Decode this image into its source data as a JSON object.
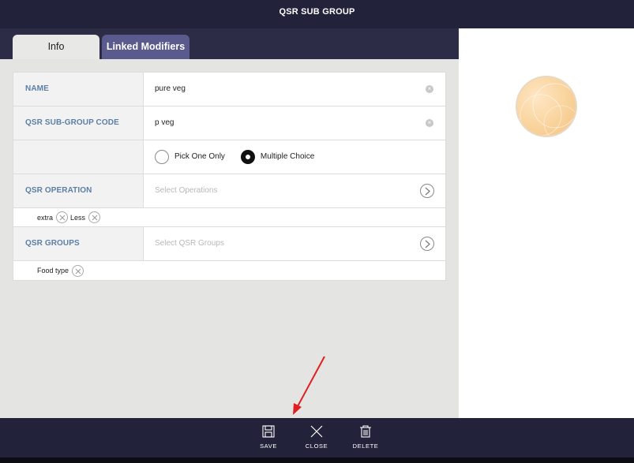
{
  "title": "QSR SUB GROUP",
  "tabs": [
    {
      "label": "Info"
    },
    {
      "label": "Linked Modifiers"
    }
  ],
  "form": {
    "name": {
      "label": "NAME",
      "value": "pure veg"
    },
    "code": {
      "label": "QSR SUB-GROUP CODE",
      "value": "p veg"
    },
    "choice": {
      "options": [
        {
          "label": "Pick One Only",
          "selected": false
        },
        {
          "label": "Multiple Choice",
          "selected": true
        }
      ]
    },
    "operation": {
      "label": "QSR OPERATION",
      "placeholder": "Select Operations",
      "chips": [
        "extra",
        "Less"
      ]
    },
    "groups": {
      "label": "QSR GROUPS",
      "placeholder": "Select QSR Groups",
      "chips": [
        "Food type"
      ]
    }
  },
  "actions": [
    {
      "label": "SAVE",
      "icon": "save-icon"
    },
    {
      "label": "CLOSE",
      "icon": "close-icon"
    },
    {
      "label": "DELETE",
      "icon": "trash-icon"
    }
  ],
  "colors": {
    "header": "#22223a",
    "tab_active": "#e8e8e6",
    "tab_inactive": "#5a5a8c",
    "label_text": "#5c7fa6",
    "annotation_arrow": "#e02020"
  }
}
